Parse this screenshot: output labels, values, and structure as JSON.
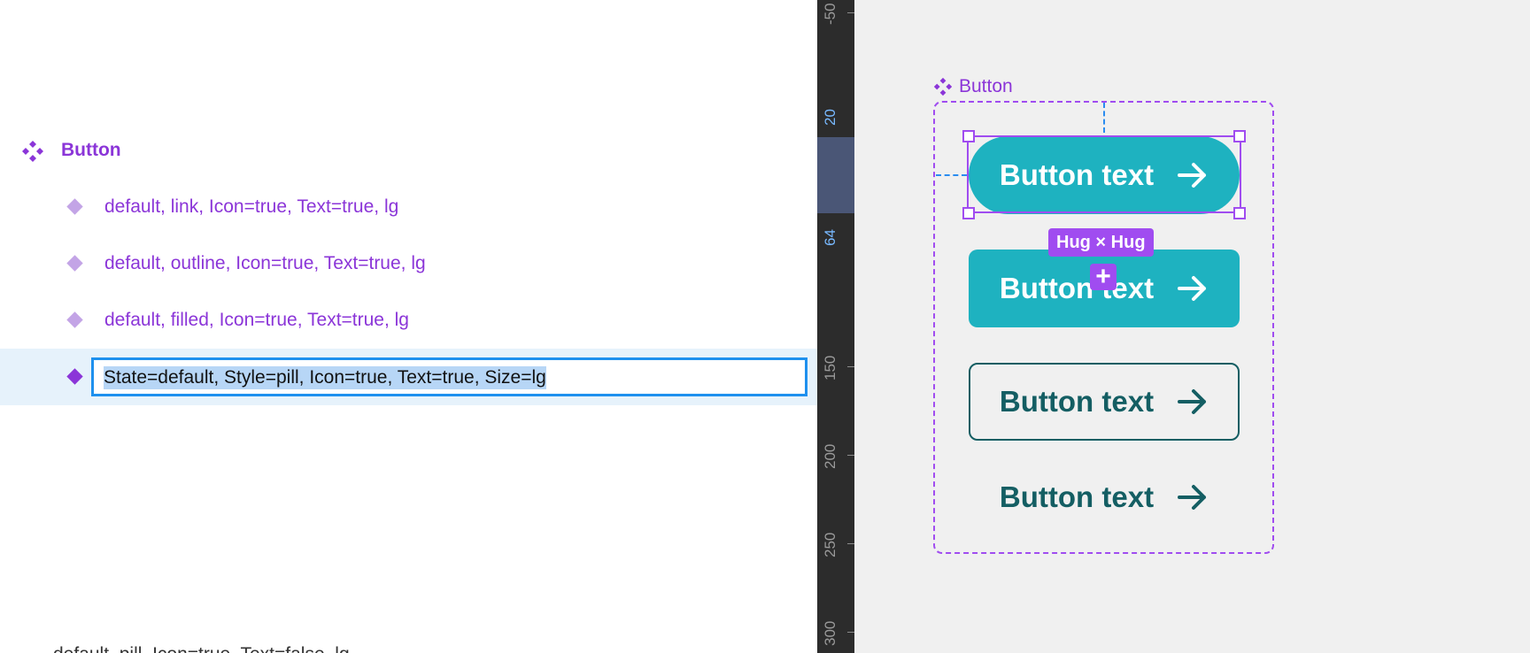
{
  "layers": {
    "component_set": {
      "icon": "component-set-icon",
      "label": "Button"
    },
    "variants": [
      {
        "icon": "variant-diamond-icon",
        "label": "default, link, Icon=true, Text=true, lg"
      },
      {
        "icon": "variant-diamond-icon",
        "label": "default, outline, Icon=true, Text=true, lg"
      },
      {
        "icon": "variant-diamond-icon",
        "label": "default, filled, Icon=true, Text=true, lg"
      }
    ],
    "renaming": {
      "icon": "variant-diamond-icon",
      "value": "State=default, Style=pill, Icon=true, Text=true, Size=lg"
    },
    "cut_off_row": "default, pill, Icon=true, Text=false, lg"
  },
  "ruler": {
    "labels": [
      "-50",
      "20",
      "64",
      "150",
      "200",
      "250",
      "300"
    ],
    "accent_labels": [
      "20",
      "64"
    ]
  },
  "canvas": {
    "frame_title": "Button",
    "frame_icon": "component-set-icon",
    "buttons": [
      {
        "style": "pill",
        "text": "Button text",
        "icon": "arrow-right-icon"
      },
      {
        "style": "filled",
        "text": "Button text",
        "icon": "arrow-right-icon"
      },
      {
        "style": "outline",
        "text": "Button text",
        "icon": "arrow-right-icon"
      },
      {
        "style": "link",
        "text": "Button text",
        "icon": "arrow-right-icon"
      }
    ],
    "size_label": "Hug × Hug",
    "add_icon": "plus-icon"
  },
  "colors": {
    "purple": "#8b35d8",
    "selection": "#a04cf0",
    "teal": "#1eb2c0",
    "dark_teal": "#145e63",
    "blue": "#1e90ee"
  }
}
